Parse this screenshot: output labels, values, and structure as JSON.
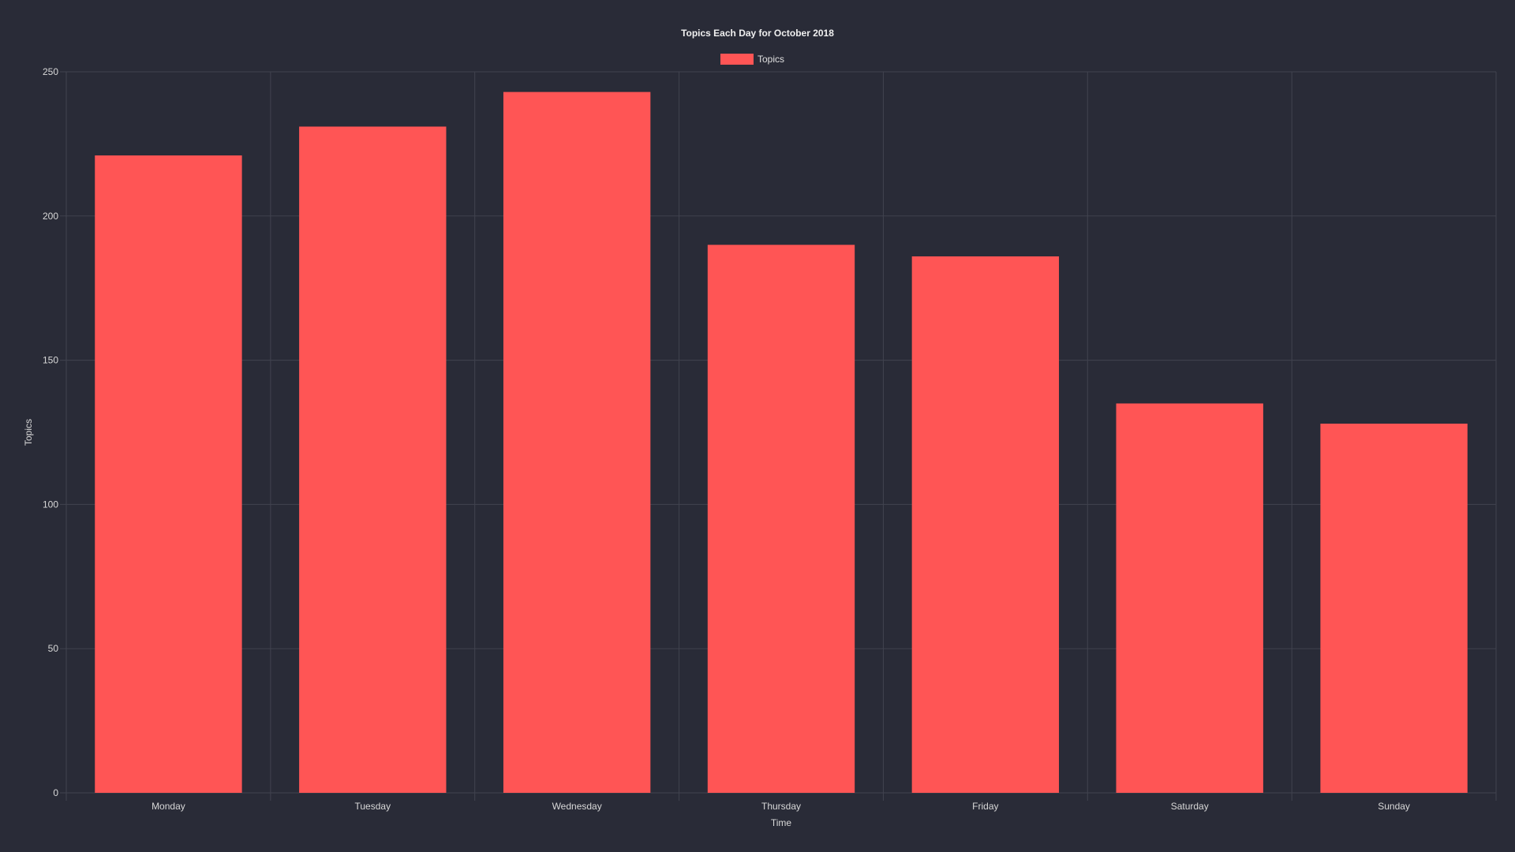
{
  "chart_data": {
    "type": "bar",
    "title": "Topics Each Day for October 2018",
    "xlabel": "Time",
    "ylabel": "Topics",
    "categories": [
      "Monday",
      "Tuesday",
      "Wednesday",
      "Thursday",
      "Friday",
      "Saturday",
      "Sunday"
    ],
    "series": [
      {
        "name": "Topics",
        "values": [
          221,
          231,
          243,
          190,
          186,
          135,
          128
        ],
        "color": "#ff5555"
      }
    ],
    "ylim": [
      0,
      250
    ],
    "yticks": [
      0,
      50,
      100,
      150,
      200,
      250
    ],
    "grid": true,
    "legend": "top-center"
  },
  "colors": {
    "background": "#292b37",
    "bar": "#ff5555",
    "grid": "#41434f",
    "text": "#d8d8d8"
  }
}
